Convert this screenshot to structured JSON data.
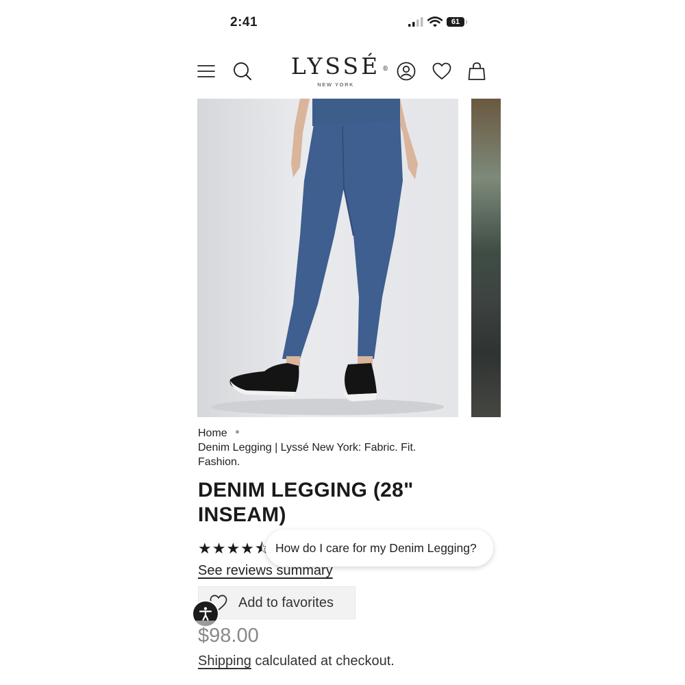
{
  "status_bar": {
    "time": "2:41",
    "battery": "61"
  },
  "header": {
    "logo": "LYSSÉ",
    "logo_mark": "®",
    "logo_subtitle": "NEW YORK",
    "icons": [
      "menu-icon",
      "search-icon",
      "account-icon",
      "wishlist-icon",
      "cart-icon"
    ]
  },
  "breadcrumb": {
    "home": "Home",
    "current": "Denim Legging | Lyssé New York: Fabric. Fit. Fashion."
  },
  "product": {
    "title": "DENIM LEGGING (28\" INSEAM)",
    "rating": 4.5,
    "rating_stars": "★★★★⯪",
    "reviews_link": "See reviews summary",
    "favorites_label": "Add to favorites",
    "price": "$98.00",
    "shipping_link": "Shipping",
    "shipping_text": " calculated at checkout."
  },
  "faq_bubble": {
    "text": "How do I care for my Denim Legging?"
  },
  "colors": {
    "denim": "#3e5f8f",
    "text": "#1c1c1c",
    "muted_price": "#888888"
  }
}
